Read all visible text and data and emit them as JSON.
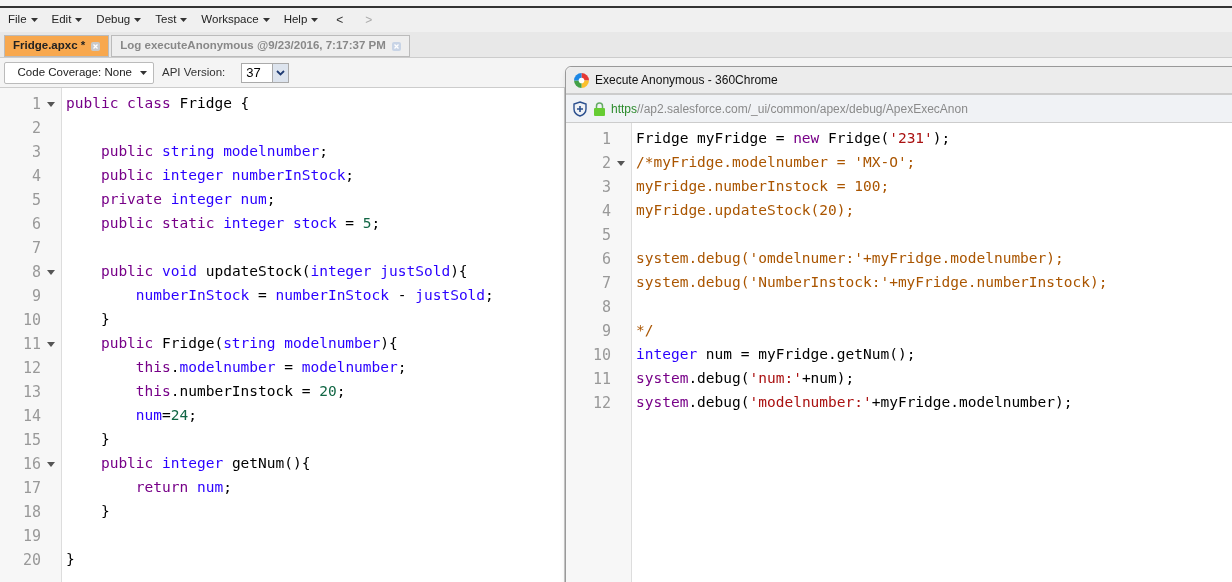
{
  "menu": [
    {
      "label": "File"
    },
    {
      "label": "Edit"
    },
    {
      "label": "Debug"
    },
    {
      "label": "Test"
    },
    {
      "label": "Workspace"
    },
    {
      "label": "Help"
    }
  ],
  "nav": [
    {
      "label": "<",
      "disabled": false
    },
    {
      "label": ">",
      "disabled": true
    }
  ],
  "tabs": [
    {
      "label": "Fridge.apxc *",
      "selected": true
    },
    {
      "label": "Log executeAnonymous @9/23/2016, 7:17:37 PM",
      "selected": false
    }
  ],
  "toolbar": {
    "coverage": "Code Coverage: None",
    "api_label": "API Version:",
    "api_value": "37"
  },
  "editor": {
    "lines": [
      {
        "number": "1",
        "fold": true,
        "tokens": [
          {
            "kind": "kw",
            "text": "public class "
          },
          {
            "kind": "plain",
            "text": "Fridge {"
          }
        ]
      },
      {
        "number": "2"
      },
      {
        "number": "3",
        "tokens": [
          {
            "kind": "kw",
            "text": "    public "
          },
          {
            "kind": "type",
            "text": "string modelnumber"
          },
          {
            "kind": "plain",
            "text": ";"
          }
        ]
      },
      {
        "number": "4",
        "tokens": [
          {
            "kind": "kw",
            "text": "    public "
          },
          {
            "kind": "type",
            "text": "integer numberInStock"
          },
          {
            "kind": "plain",
            "text": ";"
          }
        ]
      },
      {
        "number": "5",
        "tokens": [
          {
            "kind": "kw",
            "text": "    private "
          },
          {
            "kind": "type",
            "text": "integer num"
          },
          {
            "kind": "plain",
            "text": ";"
          }
        ]
      },
      {
        "number": "6",
        "tokens": [
          {
            "kind": "kw",
            "text": "    public static "
          },
          {
            "kind": "type",
            "text": "integer stock"
          },
          {
            "kind": "plain",
            "text": " = "
          },
          {
            "kind": "num",
            "text": "5"
          },
          {
            "kind": "plain",
            "text": ";"
          }
        ]
      },
      {
        "number": "7"
      },
      {
        "number": "8",
        "fold": true,
        "tokens": [
          {
            "kind": "kw",
            "text": "    public "
          },
          {
            "kind": "type",
            "text": "void "
          },
          {
            "kind": "plain",
            "text": "updateStock("
          },
          {
            "kind": "type",
            "text": "integer justSold"
          },
          {
            "kind": "plain",
            "text": "){"
          }
        ]
      },
      {
        "number": "9",
        "tokens": [
          {
            "kind": "type",
            "text": "        numberInStock"
          },
          {
            "kind": "plain",
            "text": " = "
          },
          {
            "kind": "type",
            "text": "numberInStock"
          },
          {
            "kind": "plain",
            "text": " - "
          },
          {
            "kind": "type",
            "text": "justSold"
          },
          {
            "kind": "plain",
            "text": ";"
          }
        ]
      },
      {
        "number": "10",
        "tokens": [
          {
            "kind": "plain",
            "text": "    }"
          }
        ]
      },
      {
        "number": "11",
        "fold": true,
        "tokens": [
          {
            "kind": "kw",
            "text": "    public "
          },
          {
            "kind": "plain",
            "text": "Fridge("
          },
          {
            "kind": "type",
            "text": "string modelnumber"
          },
          {
            "kind": "plain",
            "text": "){"
          }
        ]
      },
      {
        "number": "12",
        "tokens": [
          {
            "kind": "kw",
            "text": "        this"
          },
          {
            "kind": "plain",
            "text": "."
          },
          {
            "kind": "type",
            "text": "modelnumber"
          },
          {
            "kind": "plain",
            "text": " = "
          },
          {
            "kind": "type",
            "text": "modelnumber"
          },
          {
            "kind": "plain",
            "text": ";"
          }
        ]
      },
      {
        "number": "13",
        "tokens": [
          {
            "kind": "kw",
            "text": "        this"
          },
          {
            "kind": "plain",
            "text": ".numberInstock = "
          },
          {
            "kind": "num",
            "text": "20"
          },
          {
            "kind": "plain",
            "text": ";"
          }
        ]
      },
      {
        "number": "14",
        "tokens": [
          {
            "kind": "type",
            "text": "        num"
          },
          {
            "kind": "plain",
            "text": "="
          },
          {
            "kind": "num",
            "text": "24"
          },
          {
            "kind": "plain",
            "text": ";"
          }
        ]
      },
      {
        "number": "15",
        "tokens": [
          {
            "kind": "plain",
            "text": "    }"
          }
        ]
      },
      {
        "number": "16",
        "fold": true,
        "tokens": [
          {
            "kind": "kw",
            "text": "    public "
          },
          {
            "kind": "type",
            "text": "integer "
          },
          {
            "kind": "plain",
            "text": "getNum(){"
          }
        ]
      },
      {
        "number": "17",
        "tokens": [
          {
            "kind": "kw",
            "text": "        return "
          },
          {
            "kind": "type",
            "text": "num"
          },
          {
            "kind": "plain",
            "text": ";"
          }
        ]
      },
      {
        "number": "18",
        "tokens": [
          {
            "kind": "plain",
            "text": "    }"
          }
        ]
      },
      {
        "number": "19"
      },
      {
        "number": "20",
        "tokens": [
          {
            "kind": "plain",
            "text": "}"
          }
        ]
      }
    ]
  },
  "popup": {
    "title": "Execute Anonymous - 360Chrome",
    "url_scheme": "https",
    "url_rest": "//ap2.salesforce.com/_ui/common/apex/debug/ApexExecAnon",
    "lines": [
      {
        "number": "1",
        "tokens": [
          {
            "kind": "plain",
            "text": "Fridge myFridge = "
          },
          {
            "kind": "kw",
            "text": "new "
          },
          {
            "kind": "plain",
            "text": "Fridge("
          },
          {
            "kind": "str",
            "text": "'231'"
          },
          {
            "kind": "plain",
            "text": ");"
          }
        ]
      },
      {
        "number": "2",
        "fold": true,
        "tokens": [
          {
            "kind": "comment",
            "text": "/*myFridge.modelnumber = 'MX-O';"
          }
        ]
      },
      {
        "number": "3",
        "tokens": [
          {
            "kind": "comment",
            "text": "myFridge.numberInstock = 100;"
          }
        ]
      },
      {
        "number": "4",
        "tokens": [
          {
            "kind": "comment",
            "text": "myFridge.updateStock(20);"
          }
        ]
      },
      {
        "number": "5"
      },
      {
        "number": "6",
        "tokens": [
          {
            "kind": "comment",
            "text": "system.debug('omdelnumer:'+myFridge.modelnumber);"
          }
        ]
      },
      {
        "number": "7",
        "tokens": [
          {
            "kind": "comment",
            "text": "system.debug('NumberInstock:'+myFridge.numberInstock);"
          }
        ]
      },
      {
        "number": "8"
      },
      {
        "number": "9",
        "tokens": [
          {
            "kind": "comment",
            "text": "*/"
          }
        ]
      },
      {
        "number": "10",
        "tokens": [
          {
            "kind": "type",
            "text": "integer "
          },
          {
            "kind": "plain",
            "text": "num = myFridge.getNum();"
          }
        ]
      },
      {
        "number": "11",
        "tokens": [
          {
            "kind": "kw",
            "text": "system"
          },
          {
            "kind": "plain",
            "text": ".debug("
          },
          {
            "kind": "str",
            "text": "'num:'"
          },
          {
            "kind": "plain",
            "text": "+num);"
          }
        ]
      },
      {
        "number": "12",
        "tokens": [
          {
            "kind": "kw",
            "text": "system"
          },
          {
            "kind": "plain",
            "text": ".debug("
          },
          {
            "kind": "str",
            "text": "'modelnumber:'"
          },
          {
            "kind": "plain",
            "text": "+myFridge.modelnumber);"
          }
        ]
      }
    ]
  }
}
